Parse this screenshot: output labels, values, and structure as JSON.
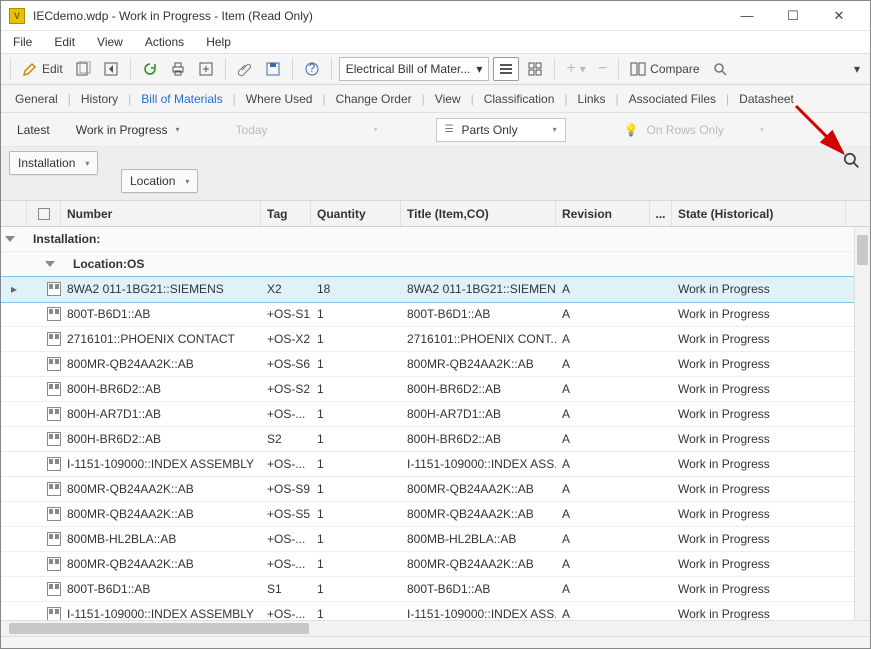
{
  "window": {
    "title": "IECdemo.wdp - Work in Progress - Item (Read Only)"
  },
  "menu": {
    "file": "File",
    "edit": "Edit",
    "view": "View",
    "actions": "Actions",
    "help": "Help"
  },
  "toolbar": {
    "edit_label": "Edit",
    "view_dropdown": "Electrical Bill of Mater...",
    "compare_label": "Compare"
  },
  "tabs": {
    "general": "General",
    "history": "History",
    "bom": "Bill of Materials",
    "whereused": "Where Used",
    "changeorder": "Change Order",
    "view": "View",
    "classification": "Classification",
    "links": "Links",
    "assoc": "Associated Files",
    "datasheet": "Datasheet"
  },
  "filters": {
    "latest": "Latest",
    "wip": "Work in Progress",
    "today": "Today",
    "mode": "Parts Only",
    "rows": "On Rows Only"
  },
  "group": {
    "level1": "Installation",
    "level2": "Location"
  },
  "columns": {
    "number": "Number",
    "tag": "Tag",
    "quantity": "Quantity",
    "title": "Title (Item,CO)",
    "revision": "Revision",
    "ell": "...",
    "state": "State (Historical)"
  },
  "groups": {
    "g1": "Installation:",
    "g2": "Location:OS"
  },
  "rows": [
    {
      "num": "8WA2 011-1BG21::SIEMENS",
      "tag": "X2",
      "qty": "18",
      "title": "8WA2 011-1BG21::SIEMENS",
      "rev": "A",
      "state": "Work in Progress",
      "selected": true
    },
    {
      "num": "800T-B6D1::AB",
      "tag": "+OS-S1",
      "qty": "1",
      "title": "800T-B6D1::AB",
      "rev": "A",
      "state": "Work in Progress"
    },
    {
      "num": "2716101::PHOENIX CONTACT",
      "tag": "+OS-X2",
      "qty": "1",
      "title": "2716101::PHOENIX CONT...",
      "rev": "A",
      "state": "Work in Progress"
    },
    {
      "num": "800MR-QB24AA2K::AB",
      "tag": "+OS-S6",
      "qty": "1",
      "title": "800MR-QB24AA2K::AB",
      "rev": "A",
      "state": "Work in Progress"
    },
    {
      "num": "800H-BR6D2::AB",
      "tag": "+OS-S2",
      "qty": "1",
      "title": "800H-BR6D2::AB",
      "rev": "A",
      "state": "Work in Progress"
    },
    {
      "num": "800H-AR7D1::AB",
      "tag": "+OS-...",
      "qty": "1",
      "title": "800H-AR7D1::AB",
      "rev": "A",
      "state": "Work in Progress"
    },
    {
      "num": "800H-BR6D2::AB",
      "tag": "S2",
      "qty": "1",
      "title": "800H-BR6D2::AB",
      "rev": "A",
      "state": "Work in Progress"
    },
    {
      "num": "I-1151-109000::INDEX ASSEMBLY",
      "tag": "+OS-...",
      "qty": "1",
      "title": "I-1151-109000::INDEX ASS...",
      "rev": "A",
      "state": "Work in Progress"
    },
    {
      "num": "800MR-QB24AA2K::AB",
      "tag": "+OS-S9",
      "qty": "1",
      "title": "800MR-QB24AA2K::AB",
      "rev": "A",
      "state": "Work in Progress"
    },
    {
      "num": "800MR-QB24AA2K::AB",
      "tag": "+OS-S5",
      "qty": "1",
      "title": "800MR-QB24AA2K::AB",
      "rev": "A",
      "state": "Work in Progress"
    },
    {
      "num": "800MB-HL2BLA::AB",
      "tag": "+OS-...",
      "qty": "1",
      "title": "800MB-HL2BLA::AB",
      "rev": "A",
      "state": "Work in Progress"
    },
    {
      "num": "800MR-QB24AA2K::AB",
      "tag": "+OS-...",
      "qty": "1",
      "title": "800MR-QB24AA2K::AB",
      "rev": "A",
      "state": "Work in Progress"
    },
    {
      "num": "800T-B6D1::AB",
      "tag": "S1",
      "qty": "1",
      "title": "800T-B6D1::AB",
      "rev": "A",
      "state": "Work in Progress"
    },
    {
      "num": "I-1151-109000::INDEX ASSEMBLY",
      "tag": "+OS-...",
      "qty": "1",
      "title": "I-1151-109000::INDEX ASS...",
      "rev": "A",
      "state": "Work in Progress"
    }
  ]
}
